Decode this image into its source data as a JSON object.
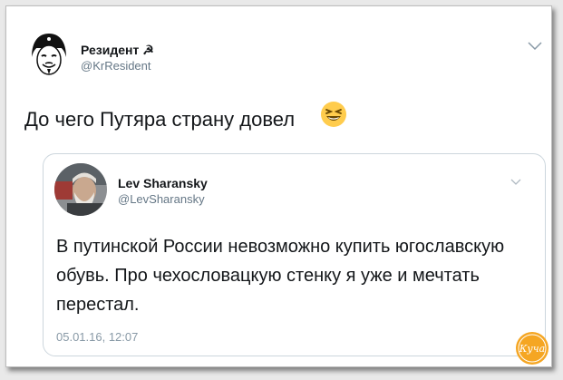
{
  "tweet": {
    "author_name": "Резидент ☭",
    "author_handle": "@KrResident",
    "text": "До чего Путяра страну довел",
    "emoji": "grinning-squinting-face-emoji",
    "menu_icon": "chevron-down-icon"
  },
  "quoted_tweet": {
    "author_name": "Lev Sharansky",
    "author_handle": "@LevSharansky",
    "text": "В путинской России невозможно купить югославскую обувь. Про чехословацкую стенку я уже и мечтать перестал.",
    "date": "05.01.16, 12:07",
    "menu_icon": "chevron-down-icon"
  },
  "watermark": {
    "text": "Куча",
    "color": "#f5a623"
  },
  "colors": {
    "text": "#14171a",
    "secondary": "#657786",
    "border": "#ccd6dd",
    "emoji": "#ffcc4d"
  }
}
